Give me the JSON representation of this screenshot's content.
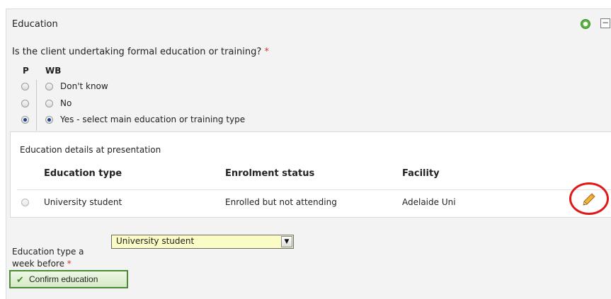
{
  "section": {
    "title": "Education"
  },
  "question": {
    "text": "Is the client undertaking formal education or training?",
    "required_mark": "*"
  },
  "columns": {
    "p": "P",
    "wb": "WB"
  },
  "options": [
    {
      "label": "Don't know",
      "p_checked": false,
      "wb_checked": false
    },
    {
      "label": "No",
      "p_checked": false,
      "wb_checked": false
    },
    {
      "label": "Yes - select main education or training type",
      "p_checked": true,
      "wb_checked": true
    }
  ],
  "details": {
    "title": "Education details at presentation",
    "headers": {
      "type": "Education type",
      "status": "Enrolment status",
      "facility": "Facility"
    },
    "rows": [
      {
        "type": "University student",
        "status": "Enrolled but not attending",
        "facility": "Adelaide Uni"
      }
    ]
  },
  "week_before": {
    "label": "Education type a week before",
    "required_mark": "*",
    "selected": "University student"
  },
  "confirm_button": {
    "label": "Confirm education"
  },
  "colors": {
    "accent_green": "#3d8f27",
    "highlight_red": "#e01818",
    "select_bg": "#fbfbc6"
  }
}
